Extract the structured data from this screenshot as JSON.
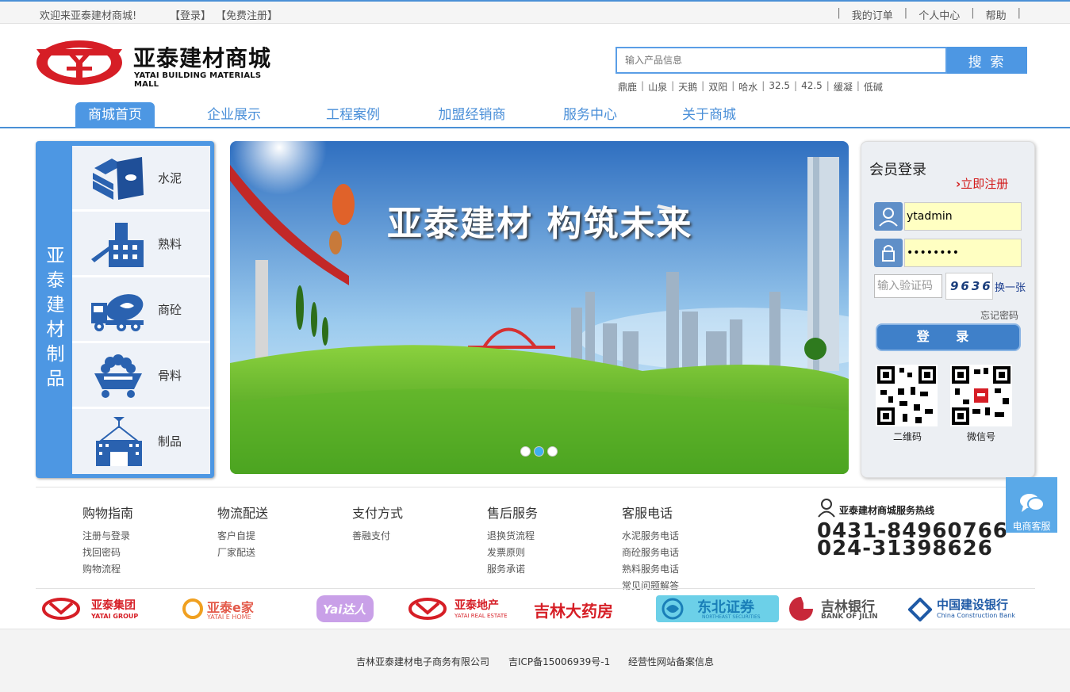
{
  "topbar": {
    "welcome": "欢迎来亚泰建材商城!",
    "login": "【登录】",
    "register": "【免费注册】",
    "links": [
      "我的订单",
      "个人中心",
      "帮助"
    ],
    "separator": "|"
  },
  "logo": {
    "cn": "亚泰建材商城",
    "en": "YATAI BUILDING MATERIALS MALL",
    "color": "#d61e26"
  },
  "search": {
    "placeholder": "输入产品信息",
    "button": "搜 索",
    "hot": [
      "鼎鹿",
      "山泉",
      "天鹅",
      "双阳",
      "哈水",
      "32.5",
      "42.5",
      "缓凝",
      "低碱"
    ]
  },
  "nav": [
    "商城首页",
    "企业展示",
    "工程案例",
    "加盟经销商",
    "服务中心",
    "关于商城"
  ],
  "categories": {
    "title": "亚泰建材制品",
    "items": [
      {
        "label": "水泥",
        "icon": "cement-bags-icon"
      },
      {
        "label": "熟料",
        "icon": "factory-icon"
      },
      {
        "label": "商砼",
        "icon": "mixer-truck-icon"
      },
      {
        "label": "骨料",
        "icon": "aggregate-cart-icon"
      },
      {
        "label": "制品",
        "icon": "crane-building-icon"
      }
    ]
  },
  "banner": {
    "slogan": "亚泰建材  构筑未来",
    "slides": 3,
    "active_slide": 2
  },
  "login": {
    "title": "会员登录",
    "register_now": "立即注册",
    "username": "ytadmin",
    "password": "••••••••",
    "captcha_placeholder": "输入验证码",
    "captcha_code": "9636",
    "change": "换一张",
    "forgot": "忘记密码",
    "submit": "登  录",
    "qr1": "二维码",
    "qr2": "微信号"
  },
  "footer_cols": [
    {
      "title": "购物指南",
      "links": [
        "注册与登录",
        "找回密码",
        "购物流程"
      ]
    },
    {
      "title": "物流配送",
      "links": [
        "客户自提",
        "厂家配送"
      ]
    },
    {
      "title": "支付方式",
      "links": [
        "善融支付"
      ]
    },
    {
      "title": "售后服务",
      "links": [
        "退换货流程",
        "发票原则",
        "服务承诺"
      ]
    },
    {
      "title": "客服电话",
      "links": [
        "水泥服务电话",
        "商砼服务电话",
        "熟料服务电话",
        "常见问题解答"
      ]
    }
  ],
  "hotline": {
    "caption": "亚泰建材商城服务热线",
    "phone1": "0431-84960766",
    "phone2": "024-31398626"
  },
  "customer_service": "电商客服",
  "partners": [
    {
      "name": "亚泰集团",
      "en": "YATAI GROUP",
      "color": "#d61e26"
    },
    {
      "name": "亚泰e家",
      "en": "YATAI E HOME",
      "color": "#e35a4a"
    },
    {
      "name": "Yai达人",
      "en": "",
      "color": "#b77ad8"
    },
    {
      "name": "亚泰地产",
      "en": "YATAI REAL ESTATE",
      "color": "#d61e26"
    },
    {
      "name": "吉林大药房",
      "en": "",
      "color": "#d61e26"
    },
    {
      "name": "东北证券",
      "en": "NORTHEAST SECURITIES",
      "color": "#1a7fb8"
    },
    {
      "name": "吉林银行",
      "en": "BANK OF JILIN",
      "color": "#c8283a"
    },
    {
      "name": "中国建设银行",
      "en": "China Construction Bank",
      "color": "#1f5aa6"
    }
  ],
  "footer": {
    "company": "吉林亚泰建材电子商务有限公司",
    "icp": "吉ICP备15006939号-1",
    "record": "经营性网站备案信息"
  }
}
